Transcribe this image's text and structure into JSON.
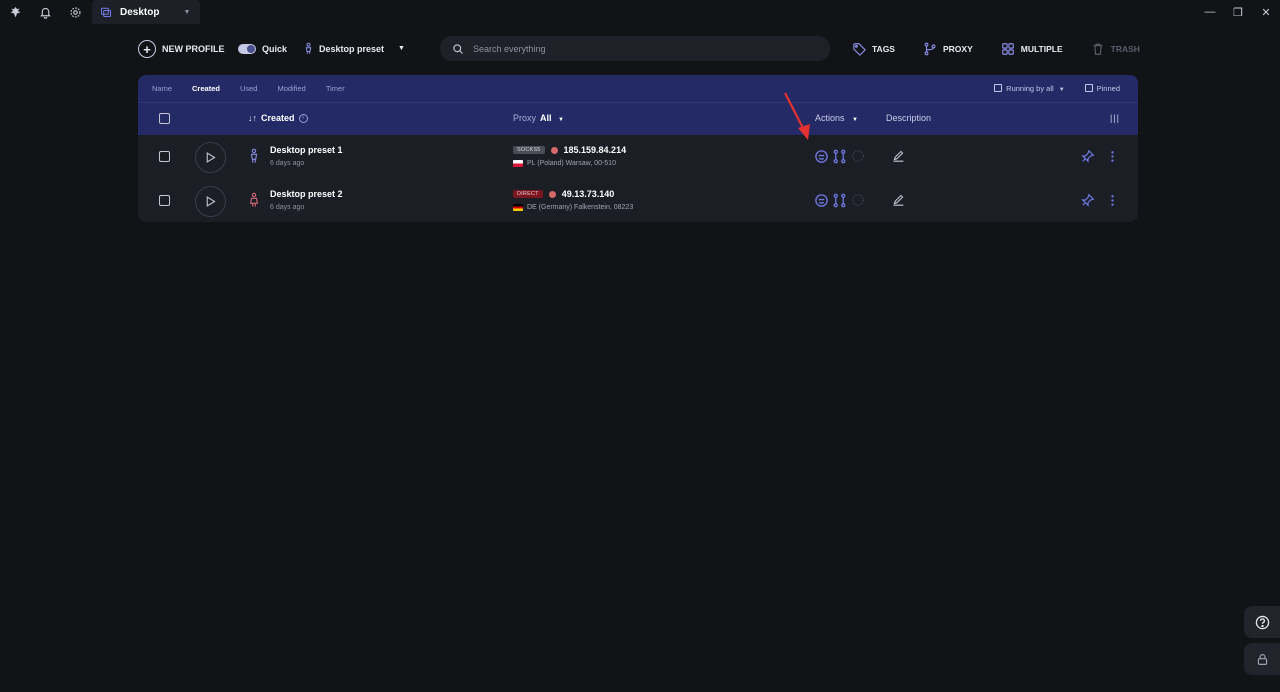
{
  "titlebar": {
    "tab_label": "Desktop",
    "icons": [
      "app-logo-icon",
      "bell-icon",
      "gear-icon",
      "desktop-tab-icon"
    ]
  },
  "toolbar": {
    "new_profile": "NEW PROFILE",
    "quick": "Quick",
    "preset": "Desktop preset",
    "search_placeholder": "Search everything",
    "tags": "TAGS",
    "proxy": "PROXY",
    "multiple": "MULTIPLE",
    "trash": "TRASH"
  },
  "table": {
    "sort_options": [
      "Name",
      "Created",
      "Used",
      "Modified",
      "Timer"
    ],
    "active_sort": "Created",
    "running_by_all": "Running by all",
    "pinned": "Pinned",
    "columns": {
      "created": "Created",
      "proxy": "Proxy",
      "proxy_filter": "All",
      "actions": "Actions",
      "description": "Description"
    },
    "rows": [
      {
        "name": "Desktop preset 1",
        "date": "6 days ago",
        "proxy_type": "SOCKS5",
        "ip": "185.159.84.214",
        "location": "PL (Poland) Warsaw, 00-510",
        "person_color": "#8b90e8"
      },
      {
        "name": "Desktop preset 2",
        "date": "6 days ago",
        "proxy_type": "DIRECT",
        "ip": "49.13.73.140",
        "location": "DE (Germany) Falkenstein, 08223",
        "person_color": "#d86b7a"
      }
    ]
  },
  "colors": {
    "background": "#121317",
    "header": "#232a66",
    "panel": "#1c1e26",
    "accent": "#6f78e0",
    "status_dot": "#d46a6a",
    "annotation": "#e5312f"
  }
}
